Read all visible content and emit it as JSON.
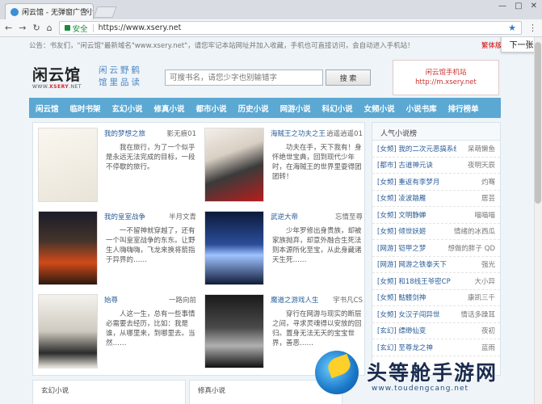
{
  "browser": {
    "tab_title": "闲云馆 - 无弹窗广告小说",
    "url": "https://www.xsery.net",
    "secure_label": "安全",
    "nav_back": "←",
    "nav_forward": "→",
    "nav_reload": "↻",
    "nav_home": "⌂",
    "win_min": "—",
    "win_max": "□",
    "win_close": "✕",
    "tab_close": "×"
  },
  "notice": {
    "text": "公告：书友们，\"闲云馆\"最新域名\"www.xsery.net\"，请您牢记本站网址并加入收藏，手机也可直接访问，会自动进入手机站！",
    "right_link": "繁体版",
    "popup": "下一张"
  },
  "header": {
    "logo": "闲云馆",
    "logo_sub_prefix": "WWW.",
    "logo_sub_brand": "XSERY",
    "logo_sub_suffix": ".NET",
    "slogan": "闲云野鹤 馆里品读",
    "search_placeholder": "可搜书名，请您少字也别输错字",
    "search_button": "搜 索",
    "mobile_title": "闲云馆手机站",
    "mobile_url": "http://m.xsery.net"
  },
  "nav": [
    "闲云馆",
    "临时书架",
    "玄幻小说",
    "修真小说",
    "都市小说",
    "历史小说",
    "网游小说",
    "科幻小说",
    "女频小说",
    "小说书库",
    "排行榜单"
  ],
  "books": [
    {
      "title": "我的梦想之旅",
      "author": "影无痕01",
      "desc": "我在旅行，为了一个似乎是永远无法完成的目标，一段不停歇的旅行。",
      "cover": "none"
    },
    {
      "title": "海贼王之功夫之王",
      "author": "逍遥逍遥01",
      "desc": "功夫在手，天下我有！身怀绝世宝典，回到现代少年时，在海贼王的世界里耍得团团转！",
      "cover": "warrior"
    },
    {
      "title": "我的皇室战争",
      "author": "半月文青",
      "desc": "一不留神就穿越了，还有一个叫皇室战争的东东。让野生人嗨嗨嗨，飞龙来换将箭指于异界的……",
      "cover": "war"
    },
    {
      "title": "武逆大帝",
      "author": "忘情至尊",
      "desc": "少年罗修出身贵族，却被家族抛弃，却意外融合生死法则本源所化至宝，从此身藏诸天生死……",
      "cover": "emperor"
    },
    {
      "title": "始尊",
      "author": "一路向前",
      "desc": "人这一生，总有一些事情必需要去经历，比如：我是谁，从哪里来，到哪里去。当然……",
      "cover": "ink"
    },
    {
      "title": "魔道之游戏人生",
      "author": "宇书凡CS",
      "desc": "穿行在网游与现实的断层之间，寻求灵魂得以安放的回归。置身无法无天的宝宝世界，善恶……",
      "cover": "dark"
    }
  ],
  "sidebar": {
    "title": "人气小说榜",
    "items": [
      {
        "title": "[女频] 我的二次元恶搞系统",
        "author": "呆萌懒鱼"
      },
      {
        "title": "[都市] 古道神元诀",
        "author": "夜明天辰"
      },
      {
        "title": "[女频] 重返有李梦月",
        "author": "灼骞"
      },
      {
        "title": "[女频] 凌波踏雁",
        "author": "居芸"
      },
      {
        "title": "[女频] 文明静蝉",
        "author": "喵喵喵"
      },
      {
        "title": "[女频] 倾世妖姬",
        "author": "情绪的冰西瓜"
      },
      {
        "title": "[网游] 铠甲之梦",
        "author": "想做的胖子 QD"
      },
      {
        "title": "[网游] 网游之铁拳天下",
        "author": "强光"
      },
      {
        "title": "[女频] 和18线王爷密CP",
        "author": "大小异"
      },
      {
        "title": "[女频] 骷髅剑神",
        "author": "康凯三千"
      },
      {
        "title": "[女频] 女汉子闯异世",
        "author": "情话多躁耳"
      },
      {
        "title": "[玄幻] 缥缈仙变",
        "author": "夜初"
      },
      {
        "title": "[玄幻] 至尊龙之神",
        "author": "蓝雨"
      }
    ]
  },
  "bottom": {
    "left_title": "玄幻小说",
    "right_title": "修真小说"
  },
  "watermark": {
    "title": "头等舱手游网",
    "url": "www.toudengcang.net"
  }
}
